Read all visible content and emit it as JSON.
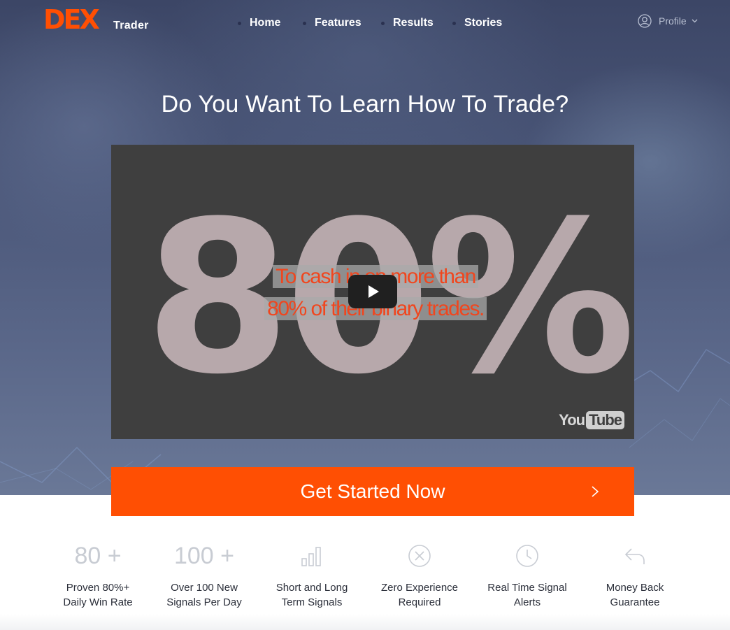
{
  "brand": {
    "logo_text": "DEX",
    "sub_label": "Trader",
    "accent_color": "#ff4f03"
  },
  "nav": {
    "items": [
      {
        "label": "Home"
      },
      {
        "label": "Features"
      },
      {
        "label": "Results"
      },
      {
        "label": "Stories"
      }
    ]
  },
  "profile": {
    "label": "Profile",
    "icon": "user-circle-icon"
  },
  "hero": {
    "headline": "Do You Want To Learn How To Trade?"
  },
  "video": {
    "big_text": "80%",
    "overlay_line1": "To cash in on more than",
    "overlay_line2": "80% of their binary trades.",
    "player_logo_you": "You",
    "player_logo_tube": "Tube",
    "play_icon": "play-icon"
  },
  "cta": {
    "label": "Get Started Now",
    "icon": "chevron-right-icon"
  },
  "features": [
    {
      "stat": "80 +",
      "line1": "Proven 80%+",
      "line2": "Daily Win Rate"
    },
    {
      "stat": "100 +",
      "line1": "Over 100 New",
      "line2": "Signals Per Day"
    },
    {
      "icon": "bar-chart-icon",
      "line1": "Short and Long",
      "line2": "Term Signals"
    },
    {
      "icon": "x-circle-icon",
      "line1": "Zero Experience",
      "line2": "Required"
    },
    {
      "icon": "clock-icon",
      "line1": "Real Time Signal",
      "line2": "Alerts"
    },
    {
      "icon": "undo-arrow-icon",
      "line1": "Money Back",
      "line2": "Guarantee"
    }
  ]
}
